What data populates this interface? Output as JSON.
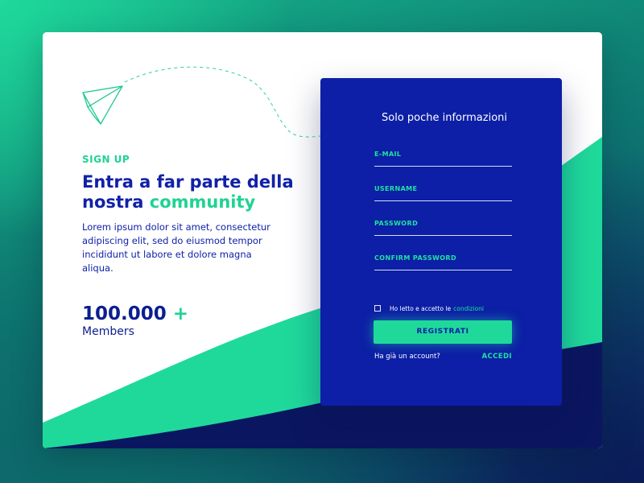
{
  "theme": {
    "accent": "#1fd393",
    "primary": "#0c1fa6",
    "dark_navy": "#0b1660",
    "background_start": "#1fd89a",
    "background_end": "#0b1b5a"
  },
  "hero": {
    "eyebrow": "SIGN UP",
    "headline_part1": "Entra a far parte della nostra",
    "headline_accent": "community",
    "description": "Lorem ipsum dolor sit amet, consectetur adipiscing elit, sed do eiusmod tempor incididunt ut labore et dolore magna aliqua.",
    "stat_value": "100.000",
    "stat_plus": "+",
    "stat_label": "Members",
    "illustration_icon": "paper-plane-icon"
  },
  "form": {
    "title": "Solo poche informazioni",
    "fields": [
      {
        "label": "E-MAIL",
        "value": ""
      },
      {
        "label": "USERNAME",
        "value": ""
      },
      {
        "label": "PASSWORD",
        "value": ""
      },
      {
        "label": "CONFIRM PASSWORD",
        "value": ""
      }
    ],
    "consent_text": "Ho letto e accetto le",
    "consent_link": "condizioni",
    "consent_checked": false,
    "submit_label": "REGISTRATI",
    "signin_prompt": "Ha già un account?",
    "signin_label": "ACCEDI"
  }
}
